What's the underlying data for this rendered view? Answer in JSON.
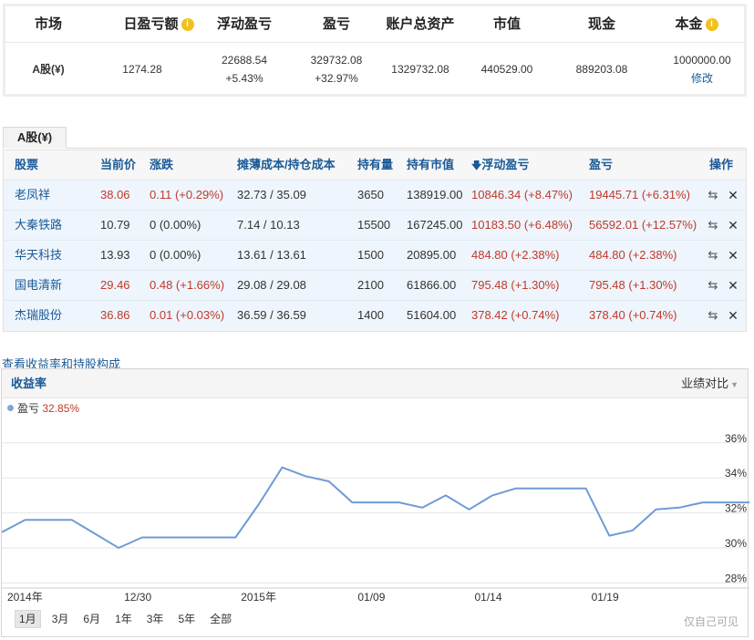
{
  "summary": {
    "headers": {
      "market": "市场",
      "daily_pl": "日盈亏额",
      "floating_pl": "浮动盈亏",
      "pl": "盈亏",
      "total_assets": "账户总资产",
      "market_value": "市值",
      "cash": "现金",
      "principal": "本金"
    },
    "info_icon": "i",
    "row": {
      "market": "A股(¥)",
      "daily_pl": "1274.28",
      "floating_pl": "22688.54",
      "floating_pl_pct": "+5.43%",
      "pl": "329732.08",
      "pl_pct": "+32.97%",
      "total_assets": "1329732.08",
      "market_value": "440529.00",
      "cash": "889203.08",
      "principal": "1000000.00",
      "edit": "修改"
    }
  },
  "holdings": {
    "tab": "A股(¥)",
    "columns": {
      "stock": "股票",
      "price": "当前价",
      "change": "涨跌",
      "cost": "摊薄成本/持仓成本",
      "qty": "持有量",
      "mv": "持有市值",
      "float_pl": "浮动盈亏",
      "pl": "盈亏",
      "ops": "操作"
    },
    "sort_arrow": "🡇",
    "rows": [
      {
        "stock": "老凤祥",
        "price": "38.06",
        "change": "0.11 (+0.29%)",
        "cost": "32.73 / 35.09",
        "qty": "3650",
        "mv": "138919.00",
        "float_pl": "10846.34 (+8.47%)",
        "pl": "19445.71 (+6.31%)",
        "price_red": true,
        "change_red": true
      },
      {
        "stock": "大秦铁路",
        "price": "10.79",
        "change": "0 (0.00%)",
        "cost": "7.14 / 10.13",
        "qty": "15500",
        "mv": "167245.00",
        "float_pl": "10183.50 (+6.48%)",
        "pl": "56592.01 (+12.57%)",
        "price_red": false,
        "change_red": false
      },
      {
        "stock": "华天科技",
        "price": "13.93",
        "change": "0 (0.00%)",
        "cost": "13.61 / 13.61",
        "qty": "1500",
        "mv": "20895.00",
        "float_pl": "484.80 (+2.38%)",
        "pl": "484.80 (+2.38%)",
        "price_red": false,
        "change_red": false
      },
      {
        "stock": "国电清新",
        "price": "29.46",
        "change": "0.48 (+1.66%)",
        "cost": "29.08 / 29.08",
        "qty": "2100",
        "mv": "61866.00",
        "float_pl": "795.48 (+1.30%)",
        "pl": "795.48 (+1.30%)",
        "price_red": true,
        "change_red": true
      },
      {
        "stock": "杰瑞股份",
        "price": "36.86",
        "change": "0.01 (+0.03%)",
        "cost": "36.59 / 36.59",
        "qty": "1400",
        "mv": "51604.00",
        "float_pl": "378.42 (+0.74%)",
        "pl": "378.40 (+0.74%)",
        "price_red": true,
        "change_red": true
      }
    ],
    "op_icons": {
      "swap": "⇆",
      "close": "✕"
    }
  },
  "chart_section": {
    "view_link": "查看收益率和持股构成",
    "title": "收益率",
    "compare": "业绩对比",
    "compare_caret": "▼",
    "legend_name": "盈亏",
    "legend_value": "32.85%",
    "ranges": [
      "1月",
      "3月",
      "6月",
      "1年",
      "3年",
      "5年",
      "全部"
    ],
    "active_range": "1月",
    "privacy": "仅自己可见"
  },
  "chart_data": {
    "type": "line",
    "series": [
      {
        "name": "盈亏",
        "values": [
          30.9,
          31.6,
          31.6,
          31.6,
          30.8,
          30.0,
          30.6,
          30.6,
          30.6,
          30.6,
          30.6,
          32.5,
          34.6,
          34.1,
          33.8,
          32.6,
          32.6,
          32.6,
          32.3,
          33.0,
          32.2,
          33.0,
          33.4,
          33.4,
          33.4,
          33.4,
          30.7,
          31.0,
          32.2,
          32.3,
          32.6,
          32.6,
          32.6
        ]
      }
    ],
    "x_tick_labels": [
      "2014年",
      "12/30",
      "2015年",
      "01/09",
      "01/14",
      "01/19"
    ],
    "y_tick_labels": [
      "36%",
      "34%",
      "32%",
      "30%",
      "28%"
    ],
    "ylim": [
      27.5,
      37.5
    ],
    "grid": true,
    "color": "#6f9bd6"
  },
  "colors": {
    "red": "#c0392b",
    "blue": "#1a5a96",
    "row_bg": "#eef5fc",
    "info_icon": "#f2c21a"
  }
}
